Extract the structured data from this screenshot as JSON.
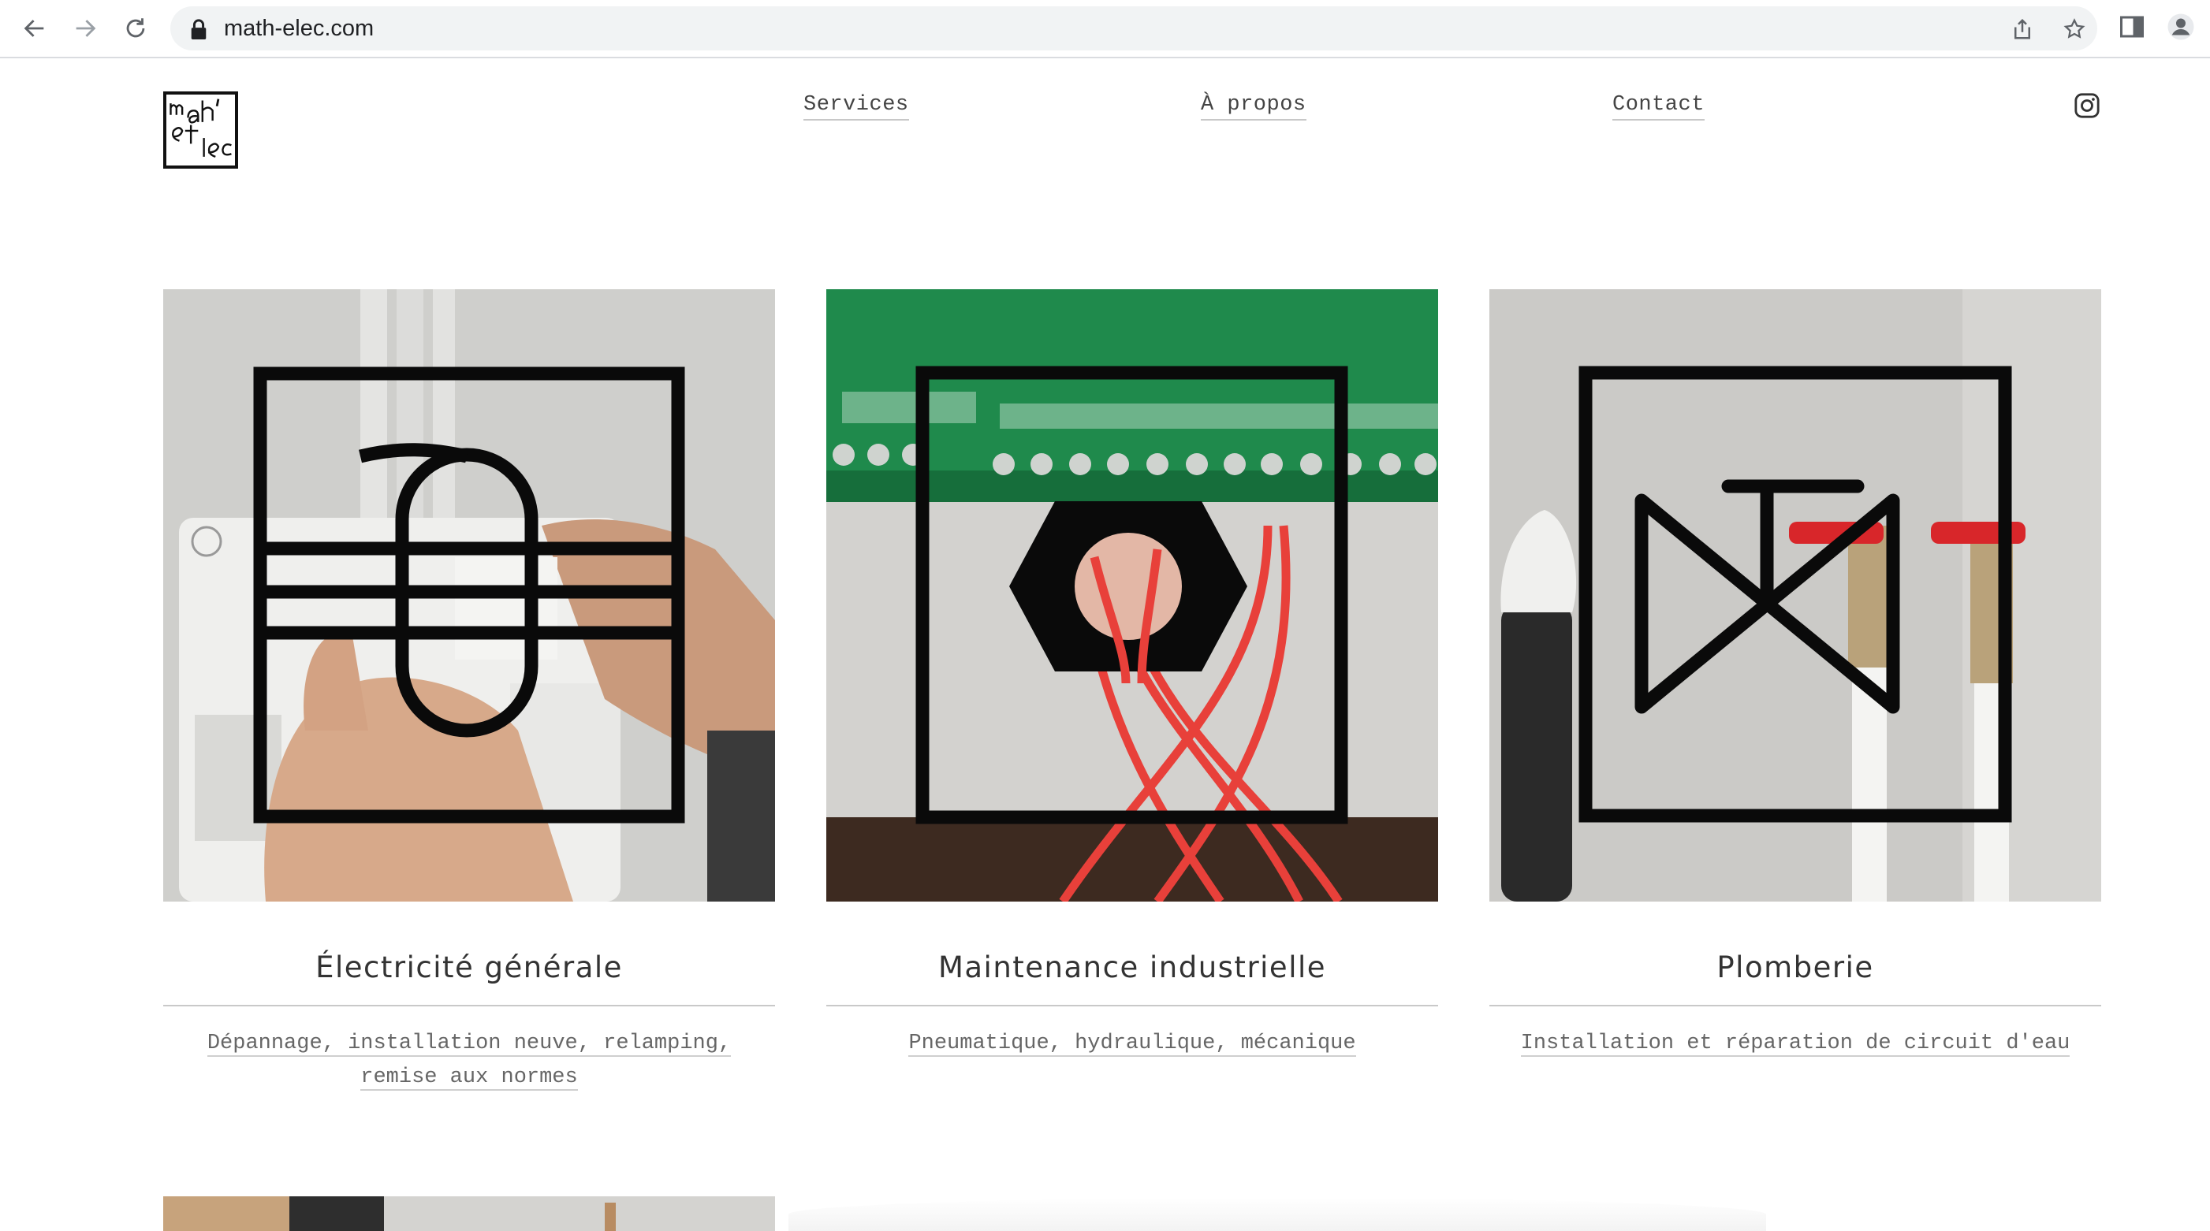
{
  "browser": {
    "url": "math-elec.com"
  },
  "site": {
    "logo_alt": "math'elec",
    "nav": {
      "services": "Services",
      "about": "À propos",
      "contact": "Contact"
    }
  },
  "services": [
    {
      "title": "Électricité générale",
      "description_lines": [
        "Dépannage, installation neuve, relamping,",
        "remise aux normes"
      ]
    },
    {
      "title": "Maintenance industrielle",
      "description_lines": [
        "Pneumatique, hydraulique, mécanique"
      ]
    },
    {
      "title": "Plomberie",
      "description_lines": [
        "Installation et réparation de circuit d'eau"
      ]
    }
  ],
  "colors": {
    "pcb_green": "#1f8a4c",
    "cable_red": "#e8403a",
    "wall_grey": "#c9c9c6",
    "symbol_black": "#0a0a0a"
  },
  "icons": [
    "back-icon",
    "forward-icon",
    "reload-icon",
    "lock-icon",
    "share-icon",
    "bookmark-star-icon",
    "side-panel-icon",
    "profile-icon",
    "instagram-icon"
  ]
}
